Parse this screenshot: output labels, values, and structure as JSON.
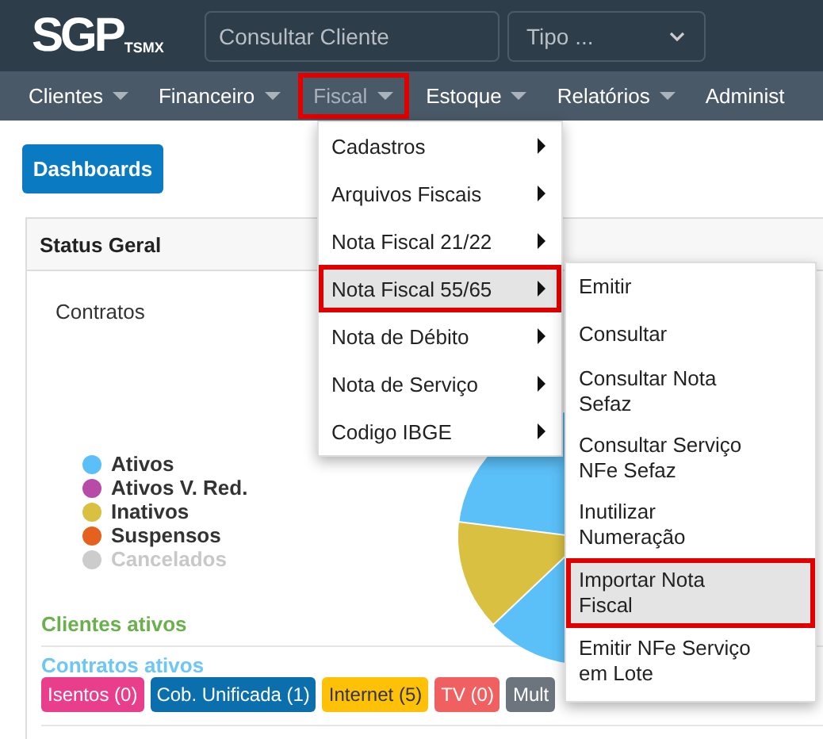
{
  "header": {
    "logo": {
      "main": "SGP",
      "sub": "TSMX"
    },
    "search": {
      "placeholder": "Consultar Cliente"
    },
    "type_select": {
      "value": "Tipo ..."
    }
  },
  "nav": [
    {
      "label": "Clientes",
      "selected": false,
      "highlighted": false
    },
    {
      "label": "Financeiro",
      "selected": false,
      "highlighted": false
    },
    {
      "label": "Fiscal",
      "selected": true,
      "highlighted": true
    },
    {
      "label": "Estoque",
      "selected": false,
      "highlighted": false
    },
    {
      "label": "Relatórios",
      "selected": false,
      "highlighted": false
    },
    {
      "label": "Administ",
      "selected": false,
      "highlighted": false
    }
  ],
  "dashboards_button": "Dashboards",
  "card": {
    "title": "Status Geral",
    "chart_title": "Contratos",
    "legend": [
      {
        "label": "Ativos",
        "color": "#5bc0f8",
        "disabled": false
      },
      {
        "label": "Ativos V. Red.",
        "color": "#b84aa8",
        "disabled": false
      },
      {
        "label": "Inativos",
        "color": "#d9c040",
        "disabled": false
      },
      {
        "label": "Suspensos",
        "color": "#e5621e",
        "disabled": false
      },
      {
        "label": "Cancelados",
        "color": "#cccccc",
        "disabled": true
      }
    ],
    "clientes_ativos": "Clientes ativos",
    "contratos_ativos": "Contratos ativos",
    "tags": [
      {
        "label": "Isentos (0)",
        "color": "#e83e8c"
      },
      {
        "label": "Cob. Unificada (1)",
        "color": "#0b6fae"
      },
      {
        "label": "Internet (5)",
        "color": "#ffc107"
      },
      {
        "label": "TV (0)",
        "color": "#f06060"
      },
      {
        "label": "Mult",
        "color": "#6c757d"
      }
    ]
  },
  "fiscal_menu": [
    {
      "label": "Cadastros",
      "selected": false,
      "highlighted": false
    },
    {
      "label": "Arquivos Fiscais",
      "selected": false,
      "highlighted": false
    },
    {
      "label": "Nota Fiscal 21/22",
      "selected": false,
      "highlighted": false
    },
    {
      "label": "Nota Fiscal 55/65",
      "selected": true,
      "highlighted": true
    },
    {
      "label": "Nota de Débito",
      "selected": false,
      "highlighted": false
    },
    {
      "label": "Nota de Serviço",
      "selected": false,
      "highlighted": false
    },
    {
      "label": "Codigo IBGE",
      "selected": false,
      "highlighted": false
    }
  ],
  "submenu": [
    {
      "label": "Emitir",
      "selected": false,
      "highlighted": false
    },
    {
      "label": "Consultar",
      "selected": false,
      "highlighted": false
    },
    {
      "label": "Consultar Nota Sefaz",
      "selected": false,
      "highlighted": false
    },
    {
      "label": "Consultar Serviço NFe Sefaz",
      "selected": false,
      "highlighted": false
    },
    {
      "label": "Inutilizar Numeração",
      "selected": false,
      "highlighted": false
    },
    {
      "label": "Importar Nota Fiscal",
      "selected": true,
      "highlighted": true
    },
    {
      "label": "Emitir NFe Serviço em Lote",
      "selected": false,
      "highlighted": false
    }
  ]
}
